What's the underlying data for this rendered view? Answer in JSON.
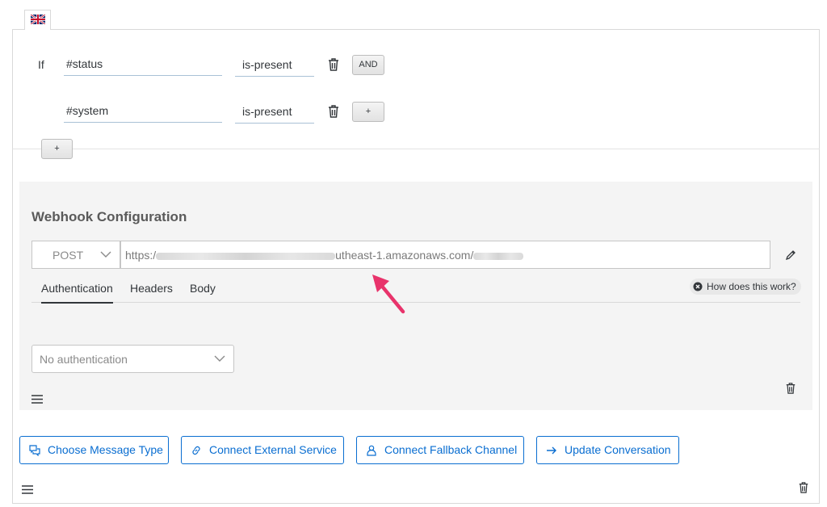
{
  "conditions": {
    "if_label": "If",
    "rows": [
      {
        "field": "#status",
        "operator": "is-present",
        "combinator": "AND"
      },
      {
        "field": "#system",
        "operator": "is-present",
        "combinator": "+"
      }
    ],
    "add_condition_label": "+"
  },
  "webhook": {
    "title": "Webhook Configuration",
    "method": "POST",
    "url_prefix": "https:/",
    "url_middle": "utheast-1.amazonaws.com/",
    "tabs": [
      "Authentication",
      "Headers",
      "Body"
    ],
    "active_tab": "Authentication",
    "help_label": "How does this work?",
    "auth_value": "No authentication"
  },
  "actions": [
    {
      "label": "Choose Message Type",
      "icon": "message-icon"
    },
    {
      "label": "Connect External Service",
      "icon": "link-icon"
    },
    {
      "label": "Connect Fallback Channel",
      "icon": "user-icon"
    },
    {
      "label": "Update Conversation",
      "icon": "arrow-right-icon"
    }
  ],
  "colors": {
    "accent": "#0a6ed1",
    "annotation": "#e8336b",
    "panel": "#f4f4f4"
  }
}
